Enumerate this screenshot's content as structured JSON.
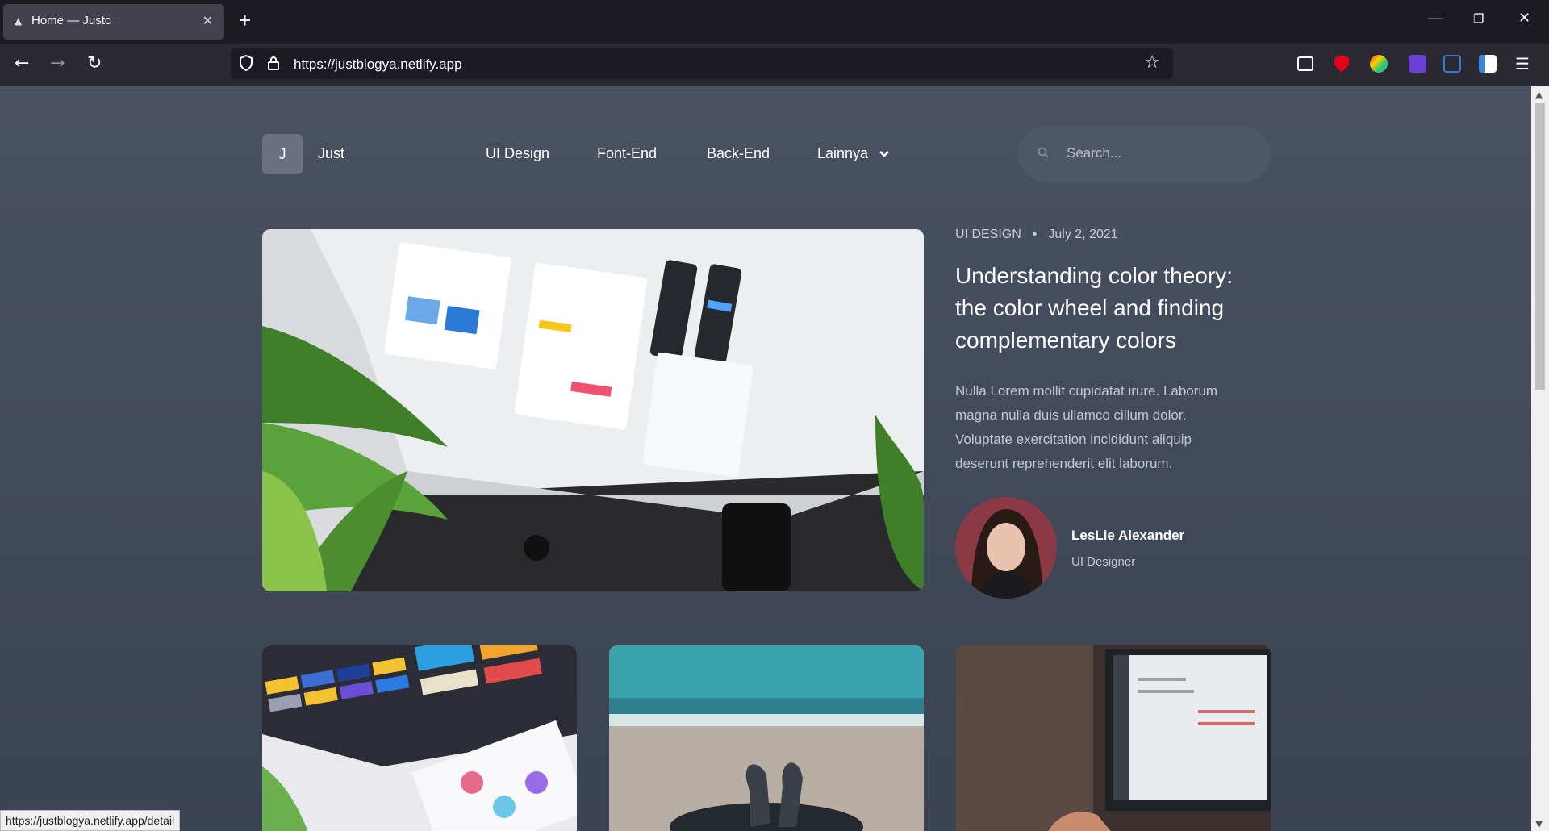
{
  "browser": {
    "tab_title": "Home — Justc",
    "new_tab": "+",
    "url": "https://justblogya.netlify.app",
    "status_url": "https://justblogya.netlify.app/detail"
  },
  "site": {
    "logo_letter": "J",
    "logo_text": "Just",
    "nav": [
      "UI Design",
      "Font-End",
      "Back-End",
      "Lainnya"
    ],
    "search_placeholder": "Search..."
  },
  "featured": {
    "category": "UI DESIGN",
    "date": "July 2, 2021",
    "title": "Understanding color theory: the color wheel and finding complementary colors",
    "excerpt": "Nulla Lorem mollit cupidatat irure. Laborum magna nulla duis ullamco cillum dolor. Voluptate exercitation incididunt aliquip deserunt reprehenderit elit laborum.",
    "author_name": "LesLie Alexander",
    "author_role": "UI Designer"
  },
  "colors": {
    "page_bg": "#3e4554",
    "chrome_dark": "#1c1b22",
    "chrome_toolbar": "#2b2a33"
  }
}
